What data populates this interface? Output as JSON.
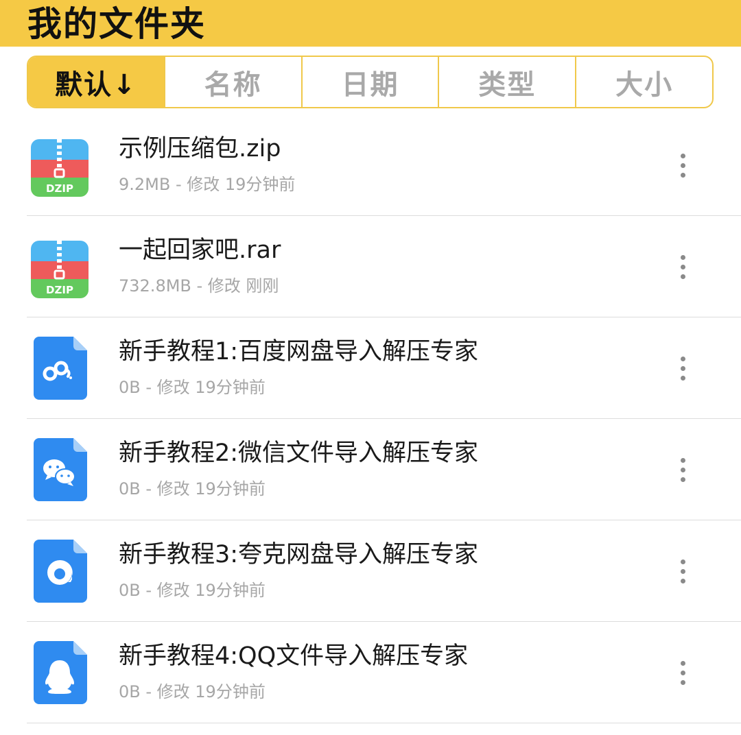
{
  "header": {
    "title": "我的文件夹"
  },
  "sort_tabs": [
    {
      "label": "默认↓",
      "active": true
    },
    {
      "label": "名称",
      "active": false
    },
    {
      "label": "日期",
      "active": false
    },
    {
      "label": "类型",
      "active": false
    },
    {
      "label": "大小",
      "active": false
    }
  ],
  "files": [
    {
      "name": "示例压缩包.zip",
      "meta": "9.2MB - 修改 19分钟前",
      "icon": "dzip-archive-icon",
      "icon_label": "DZIP"
    },
    {
      "name": "一起回家吧.rar",
      "meta": "732.8MB - 修改 刚刚",
      "icon": "dzip-archive-icon",
      "icon_label": "DZIP"
    },
    {
      "name": "新手教程1:百度网盘导入解压专家",
      "meta": "0B - 修改 19分钟前",
      "icon": "baidu-netdisk-doc-icon"
    },
    {
      "name": "新手教程2:微信文件导入解压专家",
      "meta": "0B - 修改 19分钟前",
      "icon": "wechat-doc-icon"
    },
    {
      "name": "新手教程3:夸克网盘导入解压专家",
      "meta": "0B - 修改 19分钟前",
      "icon": "quark-doc-icon"
    },
    {
      "name": "新手教程4:QQ文件导入解压专家",
      "meta": "0B - 修改 19分钟前",
      "icon": "qq-doc-icon"
    }
  ],
  "colors": {
    "accent": "#f5c945",
    "icon_blue": "#2f8bf0",
    "zip_red": "#ee5b5b",
    "zip_green": "#63c95d",
    "zip_sky": "#4fb6f1"
  }
}
